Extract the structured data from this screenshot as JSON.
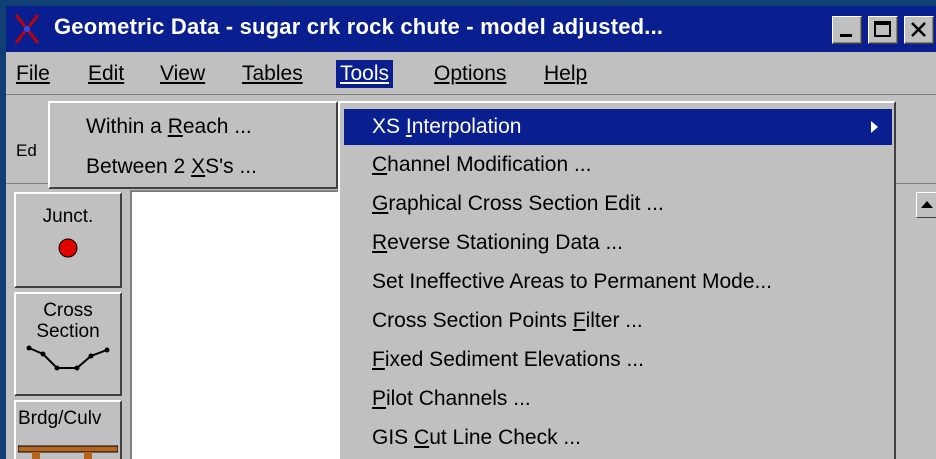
{
  "window": {
    "title": "Geometric Data - sugar crk rock chute - model adjusted...",
    "controls": [
      "minimize",
      "maximize",
      "close"
    ]
  },
  "menubar": [
    {
      "label": "File",
      "mnemonic_index": 0
    },
    {
      "label": "Edit",
      "mnemonic_index": 0
    },
    {
      "label": "View",
      "mnemonic_index": 0
    },
    {
      "label": "Tables",
      "mnemonic_index": 0
    },
    {
      "label": "Tools",
      "mnemonic_index": 0,
      "active": true
    },
    {
      "label": "Options",
      "mnemonic_index": 0
    },
    {
      "label": "Help",
      "mnemonic_index": 0
    }
  ],
  "toolbar_strip": {
    "partial_label": "Ed"
  },
  "toolbox": [
    {
      "label": "Junct.",
      "icon": "junction-red-dot-icon"
    },
    {
      "label_line1": "Cross",
      "label_line2": "Section",
      "icon": "cross-section-profile-icon"
    },
    {
      "label": "Brdg/Culv",
      "icon": "bridge-culvert-icon"
    }
  ],
  "submenu": {
    "items": [
      {
        "pre": "Within a ",
        "mn": "R",
        "post": "each ..."
      },
      {
        "pre": "Between 2 ",
        "mn": "X",
        "post": "S's ..."
      }
    ]
  },
  "tools_menu": {
    "items": [
      {
        "pre": "XS ",
        "mn": "I",
        "post": "nterpolation",
        "has_submenu": true,
        "highlighted": true
      },
      {
        "pre": "",
        "mn": "C",
        "post": "hannel Modification ..."
      },
      {
        "pre": "",
        "mn": "G",
        "post": "raphical Cross Section Edit ..."
      },
      {
        "pre": "",
        "mn": "R",
        "post": "everse Stationing Data ..."
      },
      {
        "pre": "Set Ineffective Areas to Permanent Mode...",
        "mn": "",
        "post": ""
      },
      {
        "pre": "Cross Section Points ",
        "mn": "F",
        "post": "ilter ..."
      },
      {
        "pre": "",
        "mn": "F",
        "post": "ixed Sediment Elevations ..."
      },
      {
        "pre": "",
        "mn": "P",
        "post": "ilot Channels ..."
      },
      {
        "pre": "GIS ",
        "mn": "C",
        "post": "ut Line Check ..."
      }
    ]
  },
  "colors": {
    "desktop": "#0f3f73",
    "titlebar": "#0a1f8f",
    "highlight": "#0a1f8f",
    "chrome": "#c0c0c0",
    "junction_dot": "#e00000",
    "bridge_deck": "#b5651d"
  }
}
